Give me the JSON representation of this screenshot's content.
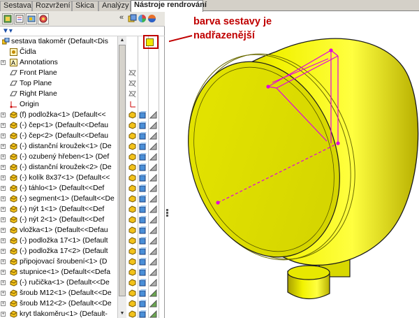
{
  "tabs": [
    {
      "label": "Sestava",
      "active": false
    },
    {
      "label": "Rozvržení",
      "active": false
    },
    {
      "label": "Skica",
      "active": false
    },
    {
      "label": "Analýzy",
      "active": false
    },
    {
      "label": "Nástroje rendrování",
      "active": true
    }
  ],
  "toolbar": {
    "collapse": "«",
    "icons": [
      "feature-manager-icon",
      "property-manager-icon",
      "configuration-manager-icon",
      "dimxpert-icon",
      "display-manager-icon",
      "appearance-icon",
      "scene-icon"
    ]
  },
  "tree": {
    "root": "sestava tlakoměr  (Default<Dis",
    "items": [
      {
        "label": "Čidla",
        "type": "folder"
      },
      {
        "label": "Annotations",
        "type": "annotation"
      },
      {
        "label": "Front Plane",
        "type": "plane"
      },
      {
        "label": "Top Plane",
        "type": "plane"
      },
      {
        "label": "Right Plane",
        "type": "plane"
      },
      {
        "label": "Origin",
        "type": "origin"
      },
      {
        "label": "(f) podložka<1> (Default<<",
        "type": "part"
      },
      {
        "label": "(-) čep<1> (Default<<Defau",
        "type": "part"
      },
      {
        "label": "(-) čep<2> (Default<<Defau",
        "type": "part"
      },
      {
        "label": "(-) distanční kroužek<1> (De",
        "type": "part"
      },
      {
        "label": "(-) ozubený hřeben<1> (Def",
        "type": "part"
      },
      {
        "label": "(-) distanční kroužek<2> (De",
        "type": "part"
      },
      {
        "label": "(-) kolík 8x37<1> (Default<<",
        "type": "part"
      },
      {
        "label": "(-) táhlo<1> (Default<<Def",
        "type": "part"
      },
      {
        "label": "(-) segment<1> (Default<<De",
        "type": "part"
      },
      {
        "label": "(-) nýt 1<1> (Default<<Def",
        "type": "part"
      },
      {
        "label": "(-) nýt 2<1> (Default<<Def",
        "type": "part"
      },
      {
        "label": "vložka<1> (Default<<Defau",
        "type": "part"
      },
      {
        "label": "(-) podložka 17<1> (Default",
        "type": "part"
      },
      {
        "label": "(-) podložka 17<2> (Default",
        "type": "part"
      },
      {
        "label": "připojovací šroubení<1> (D",
        "type": "part"
      },
      {
        "label": "stupnice<1> (Default<<Defa",
        "type": "part"
      },
      {
        "label": "(-) ručička<1> (Default<<De",
        "type": "part"
      },
      {
        "label": "šroub M12<1> (Default<<De",
        "type": "part"
      },
      {
        "label": "šroub M12<2> (Default<<De",
        "type": "part"
      },
      {
        "label": "kryt tlakoměru<1> (Default-",
        "type": "part"
      }
    ]
  },
  "annotation": {
    "line1": "barva sestavy je",
    "line2": "nadřazenější"
  },
  "colors": {
    "body_yellow": "#e8e800",
    "accent_red": "#c00000",
    "sketch_magenta": "#e000e0"
  }
}
